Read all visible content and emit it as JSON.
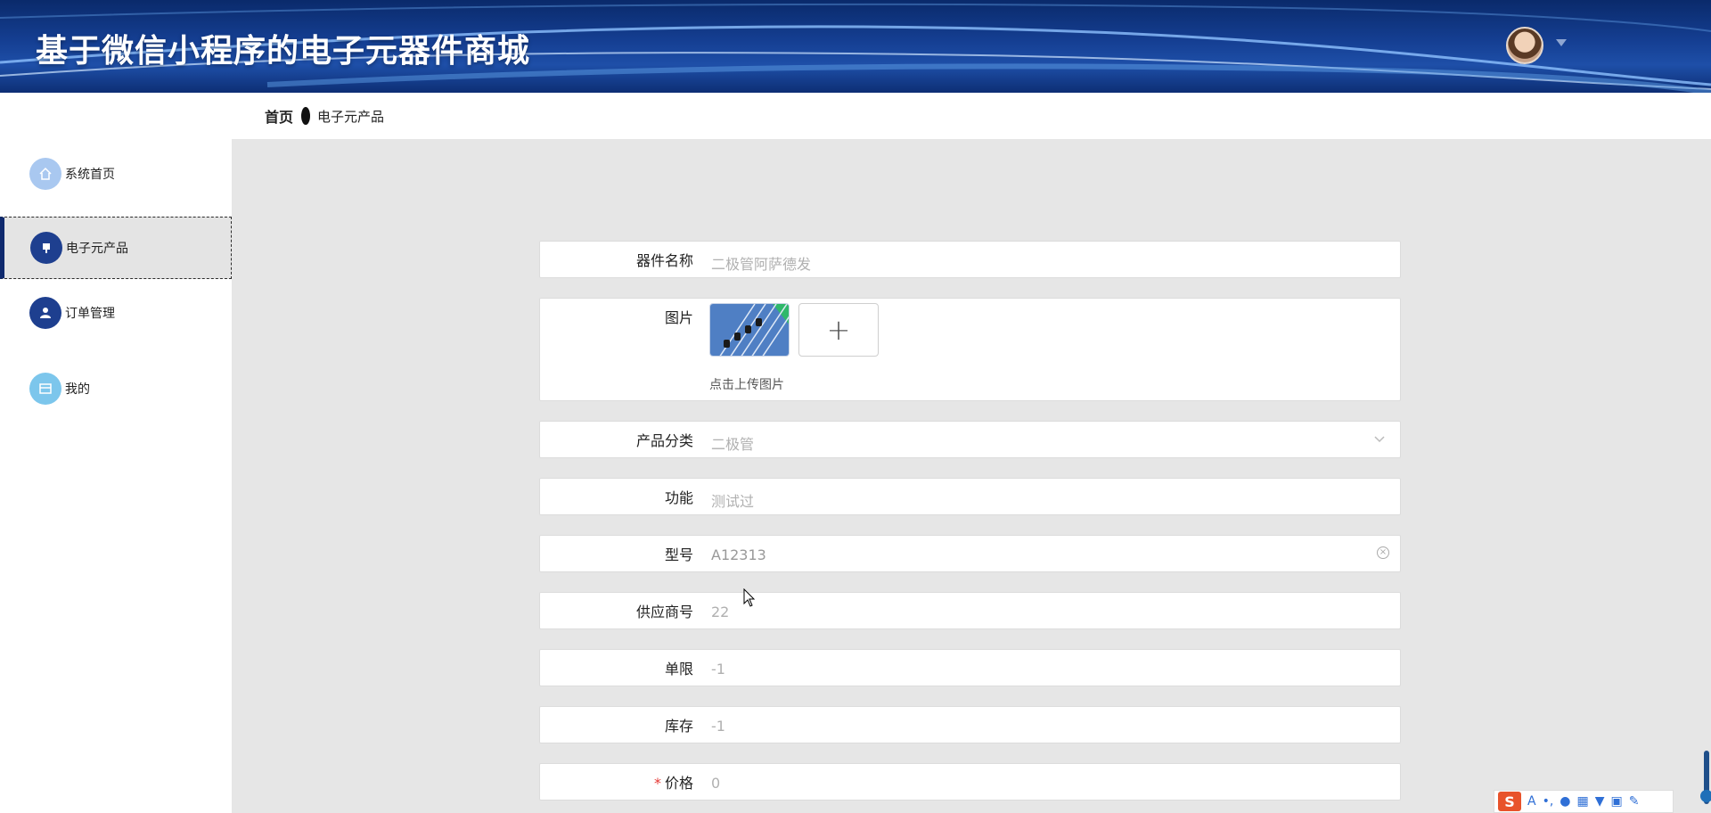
{
  "header": {
    "title": "基于微信小程序的电子元器件商城"
  },
  "sidebar": {
    "items": [
      {
        "label": "系统首页",
        "icon": "home-icon",
        "color": "#a9c8f0"
      },
      {
        "label": "电子元产品",
        "icon": "product-icon",
        "color": "#1e3f8f"
      },
      {
        "label": "订单管理",
        "icon": "user-icon",
        "color": "#1e3f8f"
      },
      {
        "label": "我的",
        "icon": "card-icon",
        "color": "#7cc6ec"
      }
    ]
  },
  "breadcrumb": {
    "home": "首页",
    "current": "电子元产品"
  },
  "form": {
    "name_label": "器件名称",
    "name_value": "二极管阿萨德发",
    "image_label": "图片",
    "upload_hint": "点击上传图片",
    "upload_plus": "+",
    "category_label": "产品分类",
    "category_value": "二极管",
    "function_label": "功能",
    "function_value": "测试过",
    "model_label": "型号",
    "model_value": "A12313",
    "supplier_label": "供应商号",
    "supplier_value": "22",
    "limit_label": "单限",
    "limit_value": "-1",
    "stock_label": "库存",
    "stock_value": "-1",
    "price_label": "价格",
    "price_value": "0",
    "required_mark": "*"
  },
  "ime": {
    "logo": "S",
    "icons": [
      "A",
      "•,",
      "mic",
      "keyboard",
      "shirt",
      "grid",
      "tool"
    ]
  }
}
